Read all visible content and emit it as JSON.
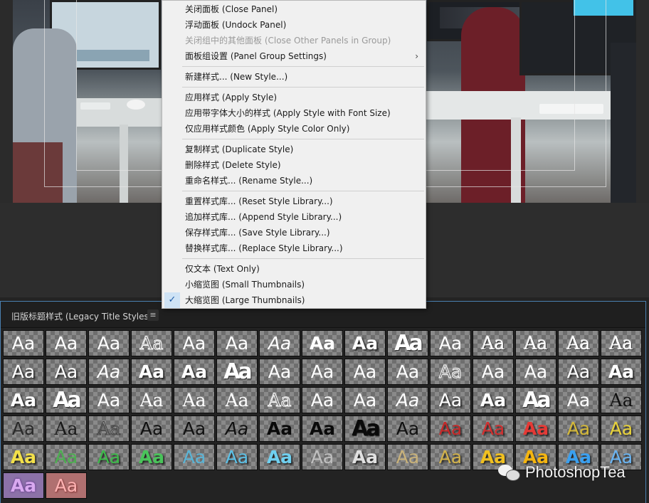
{
  "context_menu": {
    "items": [
      {
        "label": "关闭面板 (Close Panel)",
        "enabled": true
      },
      {
        "label": "浮动面板 (Undock Panel)",
        "enabled": true
      },
      {
        "label": "关闭组中的其他面板 (Close Other Panels in Group)",
        "enabled": false
      },
      {
        "label": "面板组设置 (Panel Group Settings)",
        "enabled": true,
        "submenu": true,
        "submenu_icon": "chevron-right-icon",
        "submenu_glyph": "›"
      },
      {
        "label": "新建样式... (New Style...)",
        "enabled": true
      },
      {
        "label": "应用样式 (Apply Style)",
        "enabled": true
      },
      {
        "label": "应用带字体大小的样式 (Apply Style with Font Size)",
        "enabled": true
      },
      {
        "label": "仅应用样式颜色 (Apply Style Color Only)",
        "enabled": true
      },
      {
        "label": "复制样式 (Duplicate Style)",
        "enabled": true
      },
      {
        "label": "删除样式 (Delete Style)",
        "enabled": true
      },
      {
        "label": "重命名样式... (Rename Style...)",
        "enabled": true
      },
      {
        "label": "重置样式库... (Reset Style Library...)",
        "enabled": true
      },
      {
        "label": "追加样式库... (Append Style Library...)",
        "enabled": true
      },
      {
        "label": "保存样式库... (Save Style Library...)",
        "enabled": true
      },
      {
        "label": "替换样式库... (Replace Style Library...)",
        "enabled": true
      },
      {
        "label": "仅文本 (Text Only)",
        "enabled": true
      },
      {
        "label": "小缩览图 (Small Thumbnails)",
        "enabled": true
      },
      {
        "label": "大缩览图 (Large Thumbnails)",
        "enabled": true,
        "checked": true,
        "check_icon": "checkmark-icon",
        "check_glyph": "✓"
      }
    ]
  },
  "styles_panel": {
    "title": "旧版标题样式 (Legacy Title Styles)",
    "menu_icon": "hamburger-menu-icon",
    "menu_glyph": "≡",
    "thumb_text": "Aa",
    "thumbs": [
      {
        "color": "#ffffff",
        "weight": "normal",
        "family": "sans",
        "effect": "none"
      },
      {
        "color": "#ffffff",
        "weight": "normal",
        "family": "sans",
        "effect": "none"
      },
      {
        "color": "#ffffff",
        "weight": "normal",
        "family": "sans",
        "effect": "none"
      },
      {
        "color": "#ffffff",
        "weight": "normal",
        "family": "serif",
        "effect": "outline"
      },
      {
        "color": "#ffffff",
        "weight": "normal",
        "family": "sans",
        "effect": "none"
      },
      {
        "color": "#ffffff",
        "weight": "normal",
        "family": "sans",
        "effect": "none"
      },
      {
        "color": "#ffffff",
        "weight": "normal",
        "family": "sans",
        "effect": "italic"
      },
      {
        "color": "#ffffff",
        "weight": "bold",
        "family": "sans",
        "effect": "none"
      },
      {
        "color": "#ffffff",
        "weight": "bold",
        "family": "sans",
        "effect": "shadow"
      },
      {
        "color": "#ffffff",
        "weight": "bold",
        "family": "sans",
        "effect": "condensed"
      },
      {
        "color": "#ffffff",
        "weight": "normal",
        "family": "sans",
        "effect": "none"
      },
      {
        "color": "#ffffff",
        "weight": "normal",
        "family": "serif",
        "effect": "emboss"
      },
      {
        "color": "#ffffff",
        "weight": "normal",
        "family": "serif",
        "effect": "emboss"
      },
      {
        "color": "#ffffff",
        "weight": "normal",
        "family": "serif",
        "effect": "emboss"
      },
      {
        "color": "#ffffff",
        "weight": "normal",
        "family": "serif",
        "effect": "emboss"
      },
      {
        "color": "#ffffff",
        "weight": "normal",
        "family": "sans",
        "effect": "shadow"
      },
      {
        "color": "#ffffff",
        "weight": "normal",
        "family": "sans",
        "effect": "shadow"
      },
      {
        "color": "#ffffff",
        "weight": "normal",
        "family": "sans",
        "effect": "italic"
      },
      {
        "color": "#ffffff",
        "weight": "bold",
        "family": "sans",
        "effect": "shadow"
      },
      {
        "color": "#ffffff",
        "weight": "bold",
        "family": "sans",
        "effect": "shadow"
      },
      {
        "color": "#ffffff",
        "weight": "bold",
        "family": "sans",
        "effect": "condensed"
      },
      {
        "color": "#ffffff",
        "weight": "normal",
        "family": "sans",
        "effect": "none"
      },
      {
        "color": "#ffffff",
        "weight": "normal",
        "family": "sans",
        "effect": "none"
      },
      {
        "color": "#ffffff",
        "weight": "normal",
        "family": "sans",
        "effect": "none"
      },
      {
        "color": "#ffffff",
        "weight": "normal",
        "family": "sans",
        "effect": "none"
      },
      {
        "color": "#ffffff",
        "weight": "normal",
        "family": "sans",
        "effect": "outline"
      },
      {
        "color": "#ffffff",
        "weight": "normal",
        "family": "sans",
        "effect": "none"
      },
      {
        "color": "#ffffff",
        "weight": "normal",
        "family": "sans",
        "effect": "none"
      },
      {
        "color": "#ffffff",
        "weight": "normal",
        "family": "sans",
        "effect": "shadow"
      },
      {
        "color": "#ffffff",
        "weight": "bold",
        "family": "sans",
        "effect": "shadow"
      },
      {
        "color": "#ffffff",
        "weight": "bold",
        "family": "sans",
        "effect": "shadow"
      },
      {
        "color": "#ffffff",
        "weight": "bold",
        "family": "sans",
        "effect": "condensed"
      },
      {
        "color": "#ffffff",
        "weight": "normal",
        "family": "sans",
        "effect": "none"
      },
      {
        "color": "#ffffff",
        "weight": "normal",
        "family": "serif",
        "effect": "none"
      },
      {
        "color": "#ffffff",
        "weight": "normal",
        "family": "serif",
        "effect": "none"
      },
      {
        "color": "#ffffff",
        "weight": "normal",
        "family": "serif",
        "effect": "none"
      },
      {
        "color": "#ffffff",
        "weight": "normal",
        "family": "serif",
        "effect": "outline"
      },
      {
        "color": "#ffffff",
        "weight": "normal",
        "family": "sans",
        "effect": "none"
      },
      {
        "color": "#ffffff",
        "weight": "normal",
        "family": "sans",
        "effect": "none"
      },
      {
        "color": "#ffffff",
        "weight": "normal",
        "family": "sans",
        "effect": "italic"
      },
      {
        "color": "#ffffff",
        "weight": "normal",
        "family": "sans",
        "effect": "shadow"
      },
      {
        "color": "#ffffff",
        "weight": "bold",
        "family": "sans",
        "effect": "shadow"
      },
      {
        "color": "#ffffff",
        "weight": "bold",
        "family": "sans",
        "effect": "condensed"
      },
      {
        "color": "#ffffff",
        "weight": "normal",
        "family": "sans",
        "effect": "none"
      },
      {
        "color": "#111111",
        "weight": "normal",
        "family": "serif",
        "effect": "none"
      },
      {
        "color": "#2a2a2a",
        "weight": "normal",
        "family": "sans",
        "effect": "none"
      },
      {
        "color": "#1a1a1a",
        "weight": "normal",
        "family": "serif",
        "effect": "none"
      },
      {
        "color": "#444444",
        "weight": "normal",
        "family": "serif",
        "effect": "outline"
      },
      {
        "color": "#111111",
        "weight": "normal",
        "family": "sans",
        "effect": "none"
      },
      {
        "color": "#111111",
        "weight": "normal",
        "family": "sans",
        "effect": "none"
      },
      {
        "color": "#111111",
        "weight": "normal",
        "family": "sans",
        "effect": "italic"
      },
      {
        "color": "#0a0a0a",
        "weight": "bold",
        "family": "sans",
        "effect": "none"
      },
      {
        "color": "#0a0a0a",
        "weight": "bold",
        "family": "sans",
        "effect": "none"
      },
      {
        "color": "#0a0a0a",
        "weight": "bold",
        "family": "sans",
        "effect": "condensed"
      },
      {
        "color": "#111111",
        "weight": "normal",
        "family": "sans",
        "effect": "none"
      },
      {
        "color": "#c62828",
        "weight": "normal",
        "family": "sans",
        "effect": "shadow"
      },
      {
        "color": "#d32f2f",
        "weight": "normal",
        "family": "sans",
        "effect": "shadow"
      },
      {
        "color": "#e53935",
        "weight": "bold",
        "family": "sans",
        "effect": "shadow"
      },
      {
        "color": "#d4b838",
        "weight": "normal",
        "family": "sans",
        "effect": "shadow"
      },
      {
        "color": "#e8d23a",
        "weight": "normal",
        "family": "sans",
        "effect": "shadow"
      },
      {
        "color": "#f2e04a",
        "weight": "bold",
        "family": "sans",
        "effect": "shadow"
      },
      {
        "color": "#4caf50",
        "weight": "normal",
        "family": "sans",
        "effect": "none"
      },
      {
        "color": "#3dbb4a",
        "weight": "normal",
        "family": "sans",
        "effect": "shadow"
      },
      {
        "color": "#49c45a",
        "weight": "bold",
        "family": "sans",
        "effect": "shadow"
      },
      {
        "color": "#5ab4d6",
        "weight": "normal",
        "family": "sans",
        "effect": "none"
      },
      {
        "color": "#5cc0e6",
        "weight": "normal",
        "family": "sans",
        "effect": "shadow"
      },
      {
        "color": "#6fd0f0",
        "weight": "bold",
        "family": "sans",
        "effect": "shadow"
      },
      {
        "color": "#bfbfbf",
        "weight": "normal",
        "family": "sans",
        "effect": "none"
      },
      {
        "color": "#e0e0e0",
        "weight": "bold",
        "family": "sans",
        "effect": "shadow"
      },
      {
        "color": "#c9b27a",
        "weight": "normal",
        "family": "sans",
        "effect": "none"
      },
      {
        "color": "#d2b24a",
        "weight": "normal",
        "family": "sans",
        "effect": "shadow"
      },
      {
        "color": "#f0c020",
        "weight": "bold",
        "family": "sans",
        "effect": "shadow"
      },
      {
        "color": "#f5b50f",
        "weight": "bold",
        "family": "sans",
        "effect": "shadow"
      },
      {
        "color": "#3aa0f0",
        "weight": "bold",
        "family": "sans",
        "effect": "shadow"
      },
      {
        "color": "#6ab4f2",
        "weight": "normal",
        "family": "sans",
        "effect": "shadow"
      },
      {
        "color": "#d9a9f0",
        "weight": "bold",
        "family": "sans",
        "effect": "purple"
      },
      {
        "color": "#ffb3b3",
        "weight": "normal",
        "family": "sans",
        "effect": "pink"
      }
    ]
  },
  "watermark": {
    "icon": "wechat-icon",
    "text": "PhotoshopTea"
  }
}
